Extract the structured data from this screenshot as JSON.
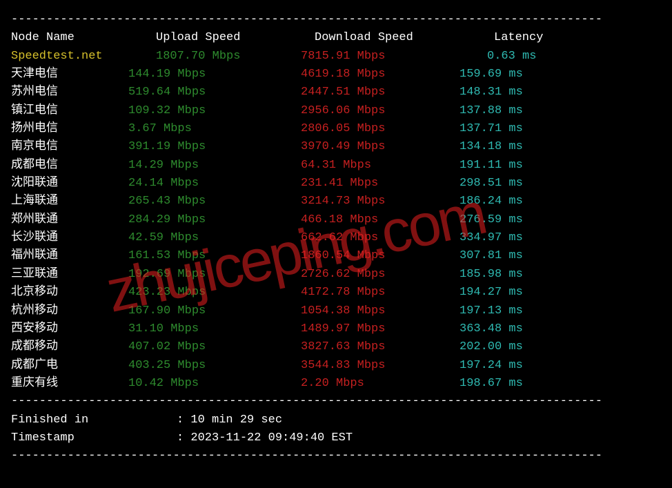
{
  "headers": {
    "node": "Node Name",
    "upload": "Upload Speed",
    "download": "Download Speed",
    "latency": "Latency"
  },
  "rows": [
    {
      "node": "Speedtest.net",
      "upload": "1807.70 Mbps",
      "download": "7815.91 Mbps",
      "latency": "0.63 ms",
      "first": true
    },
    {
      "node": "天津电信",
      "upload": "144.19 Mbps",
      "download": "4619.18 Mbps",
      "latency": "159.69 ms"
    },
    {
      "node": "苏州电信",
      "upload": "519.64 Mbps",
      "download": "2447.51 Mbps",
      "latency": "148.31 ms"
    },
    {
      "node": "镇江电信",
      "upload": "109.32 Mbps",
      "download": "2956.06 Mbps",
      "latency": "137.88 ms"
    },
    {
      "node": "扬州电信",
      "upload": "3.67 Mbps",
      "download": "2806.05 Mbps",
      "latency": "137.71 ms"
    },
    {
      "node": "南京电信",
      "upload": "391.19 Mbps",
      "download": "3970.49 Mbps",
      "latency": "134.18 ms"
    },
    {
      "node": "成都电信",
      "upload": "14.29 Mbps",
      "download": "64.31 Mbps",
      "latency": "191.11 ms"
    },
    {
      "node": "沈阳联通",
      "upload": "24.14 Mbps",
      "download": "231.41 Mbps",
      "latency": "298.51 ms"
    },
    {
      "node": "上海联通",
      "upload": "265.43 Mbps",
      "download": "3214.73 Mbps",
      "latency": "186.24 ms"
    },
    {
      "node": "郑州联通",
      "upload": "284.29 Mbps",
      "download": "466.18 Mbps",
      "latency": "276.59 ms"
    },
    {
      "node": "长沙联通",
      "upload": "42.59 Mbps",
      "download": "662.62 Mbps",
      "latency": "334.97 ms"
    },
    {
      "node": "福州联通",
      "upload": "161.53 Mbps",
      "download": "1860.54 Mbps",
      "latency": "307.81 ms"
    },
    {
      "node": "三亚联通",
      "upload": "192.69 Mbps",
      "download": "2726.62 Mbps",
      "latency": "185.98 ms"
    },
    {
      "node": "北京移动",
      "upload": "423.23 Mbps",
      "download": "4172.78 Mbps",
      "latency": "194.27 ms"
    },
    {
      "node": "杭州移动",
      "upload": "167.90 Mbps",
      "download": "1054.38 Mbps",
      "latency": "197.13 ms"
    },
    {
      "node": "西安移动",
      "upload": "31.10 Mbps",
      "download": "1489.97 Mbps",
      "latency": "363.48 ms"
    },
    {
      "node": "成都移动",
      "upload": "407.02 Mbps",
      "download": "3827.63 Mbps",
      "latency": "202.00 ms"
    },
    {
      "node": "成都广电",
      "upload": "403.25 Mbps",
      "download": "3544.83 Mbps",
      "latency": "197.24 ms"
    },
    {
      "node": "重庆有线",
      "upload": "10.42 Mbps",
      "download": "2.20 Mbps",
      "latency": "198.67 ms"
    }
  ],
  "footer": {
    "finished_label": "Finished in",
    "finished_value": "10 min 29 sec",
    "timestamp_label": "Timestamp",
    "timestamp_value": "2023-11-22 09:49:40 EST"
  },
  "watermark": "zhujiceping.com",
  "divider": "------------------------------------------------------------------------------------"
}
